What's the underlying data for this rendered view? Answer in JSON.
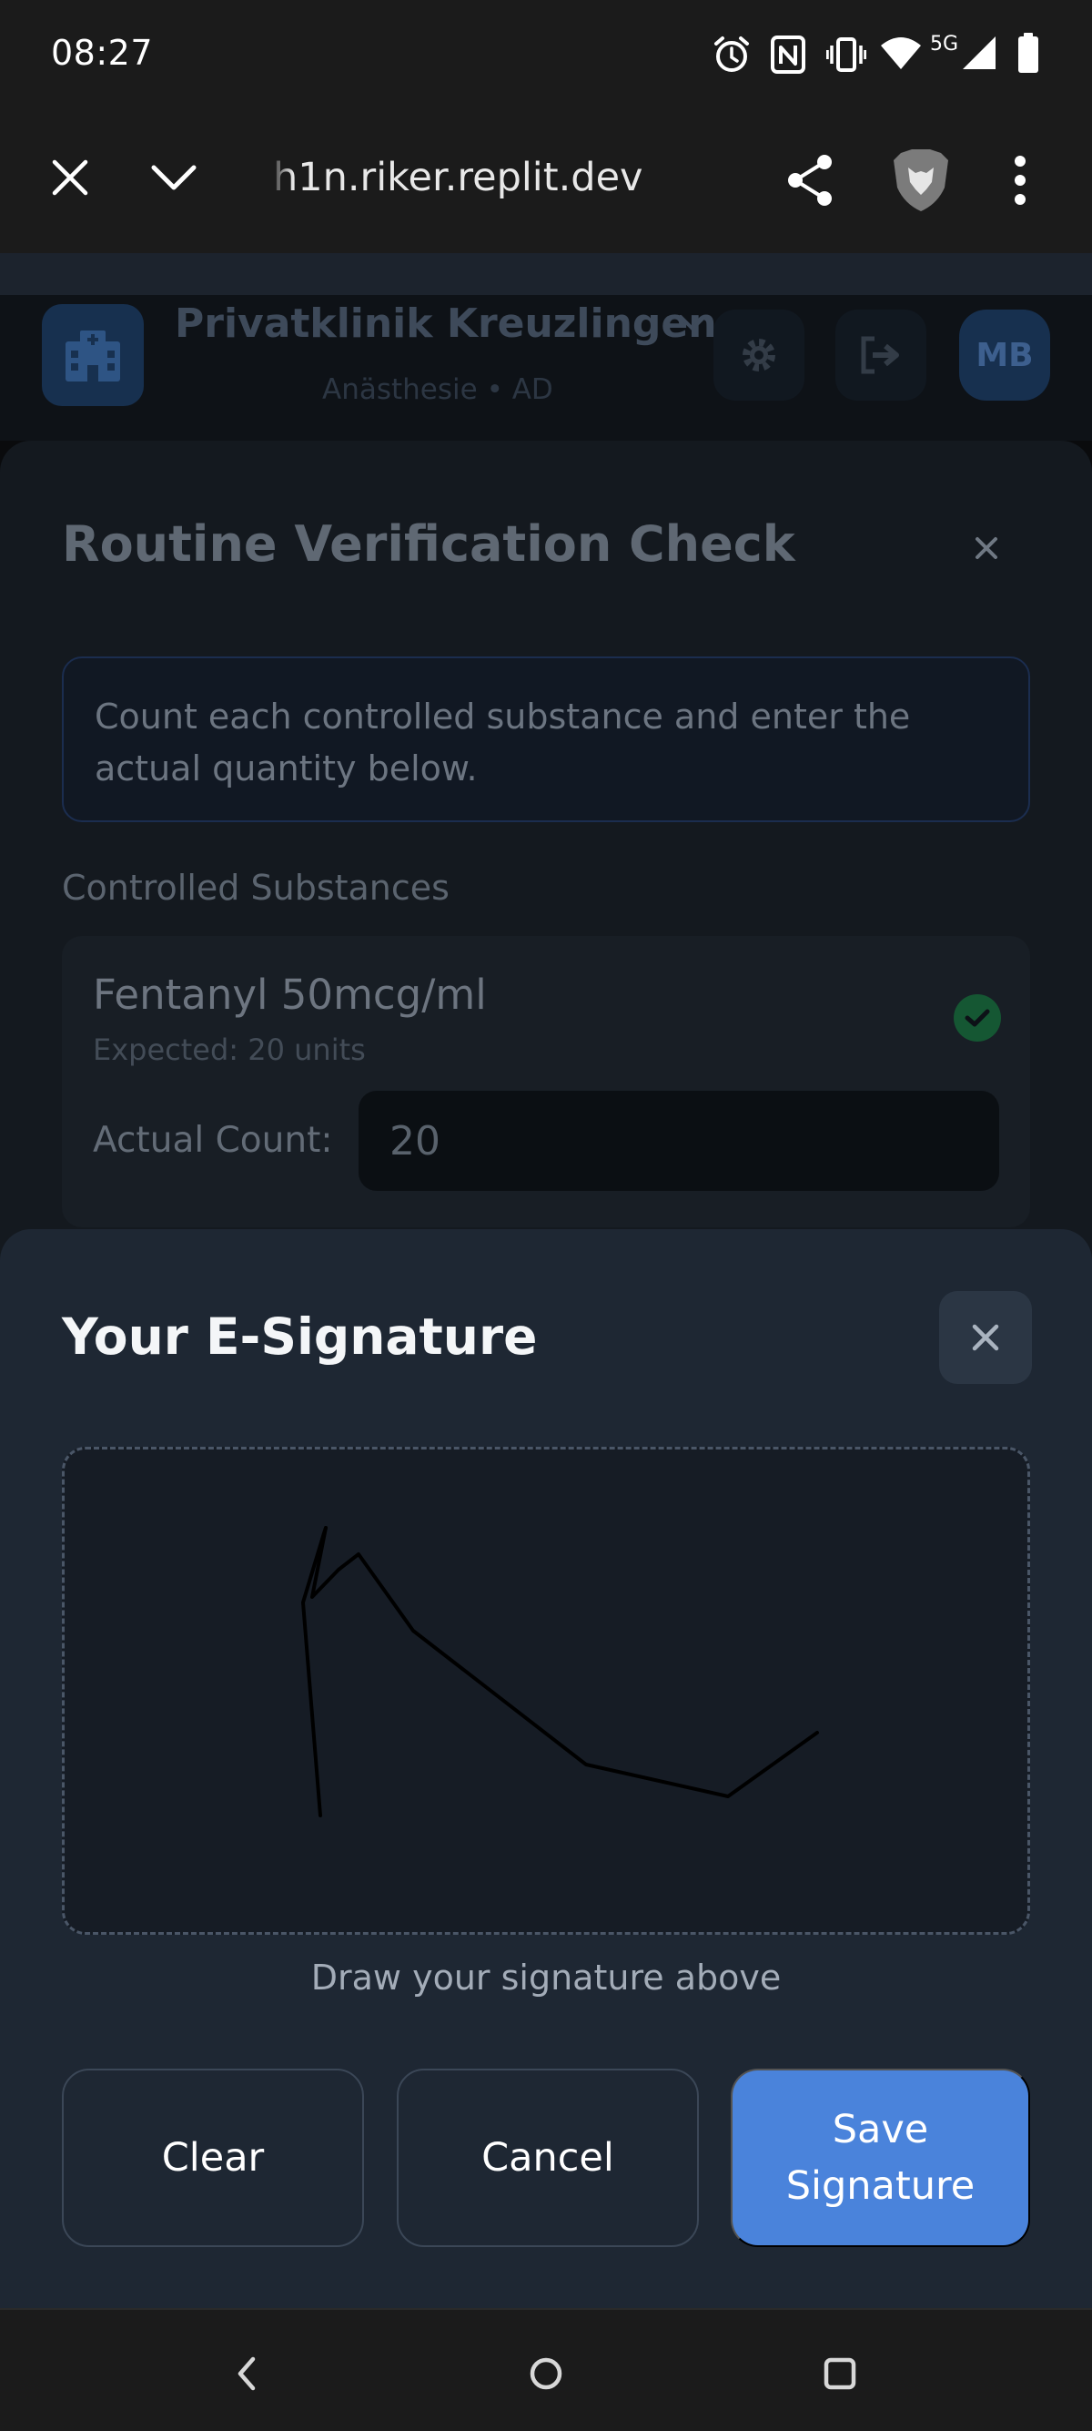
{
  "status_bar": {
    "time": "08:27",
    "icons": [
      "alarm-icon",
      "nfc-icon",
      "vibrate-icon",
      "wifi-icon",
      "5g-icon",
      "signal-icon",
      "battery-icon"
    ],
    "network_label": "5G"
  },
  "browser": {
    "url": "h1n.riker.replit.dev",
    "icons": [
      "close-icon",
      "chevron-down-icon",
      "share-icon",
      "brave-lion-icon",
      "more-vertical-icon"
    ]
  },
  "app_header": {
    "clinic_name": "Privatklinik Kreuzlingen",
    "clinic_sub": "Anästhesie • AD",
    "avatar_initials": "MB",
    "icons": [
      "hospital-icon",
      "chevron-down-icon",
      "gear-icon",
      "logout-icon"
    ]
  },
  "verification": {
    "title": "Routine Verification Check",
    "close_symbol": "×",
    "note": "Count each controlled substance and enter the actual quantity below.",
    "section_label": "Controlled Substances",
    "substance": {
      "name": "Fentanyl 50mcg/ml",
      "expected": "Expected: 20 units",
      "count_label": "Actual Count:",
      "count_value": "20",
      "status_icon": "check-circle-icon"
    }
  },
  "signature": {
    "title": "Your E-Signature",
    "hint": "Draw your signature above",
    "buttons": {
      "clear": "Clear",
      "cancel": "Cancel",
      "save": "Save Signature"
    }
  },
  "nav_bar": {
    "icons": [
      "back-icon",
      "home-icon",
      "recents-icon"
    ]
  },
  "colors": {
    "accent": "#4a83db",
    "sheet_bg": "#1e2733",
    "success": "#155733"
  }
}
